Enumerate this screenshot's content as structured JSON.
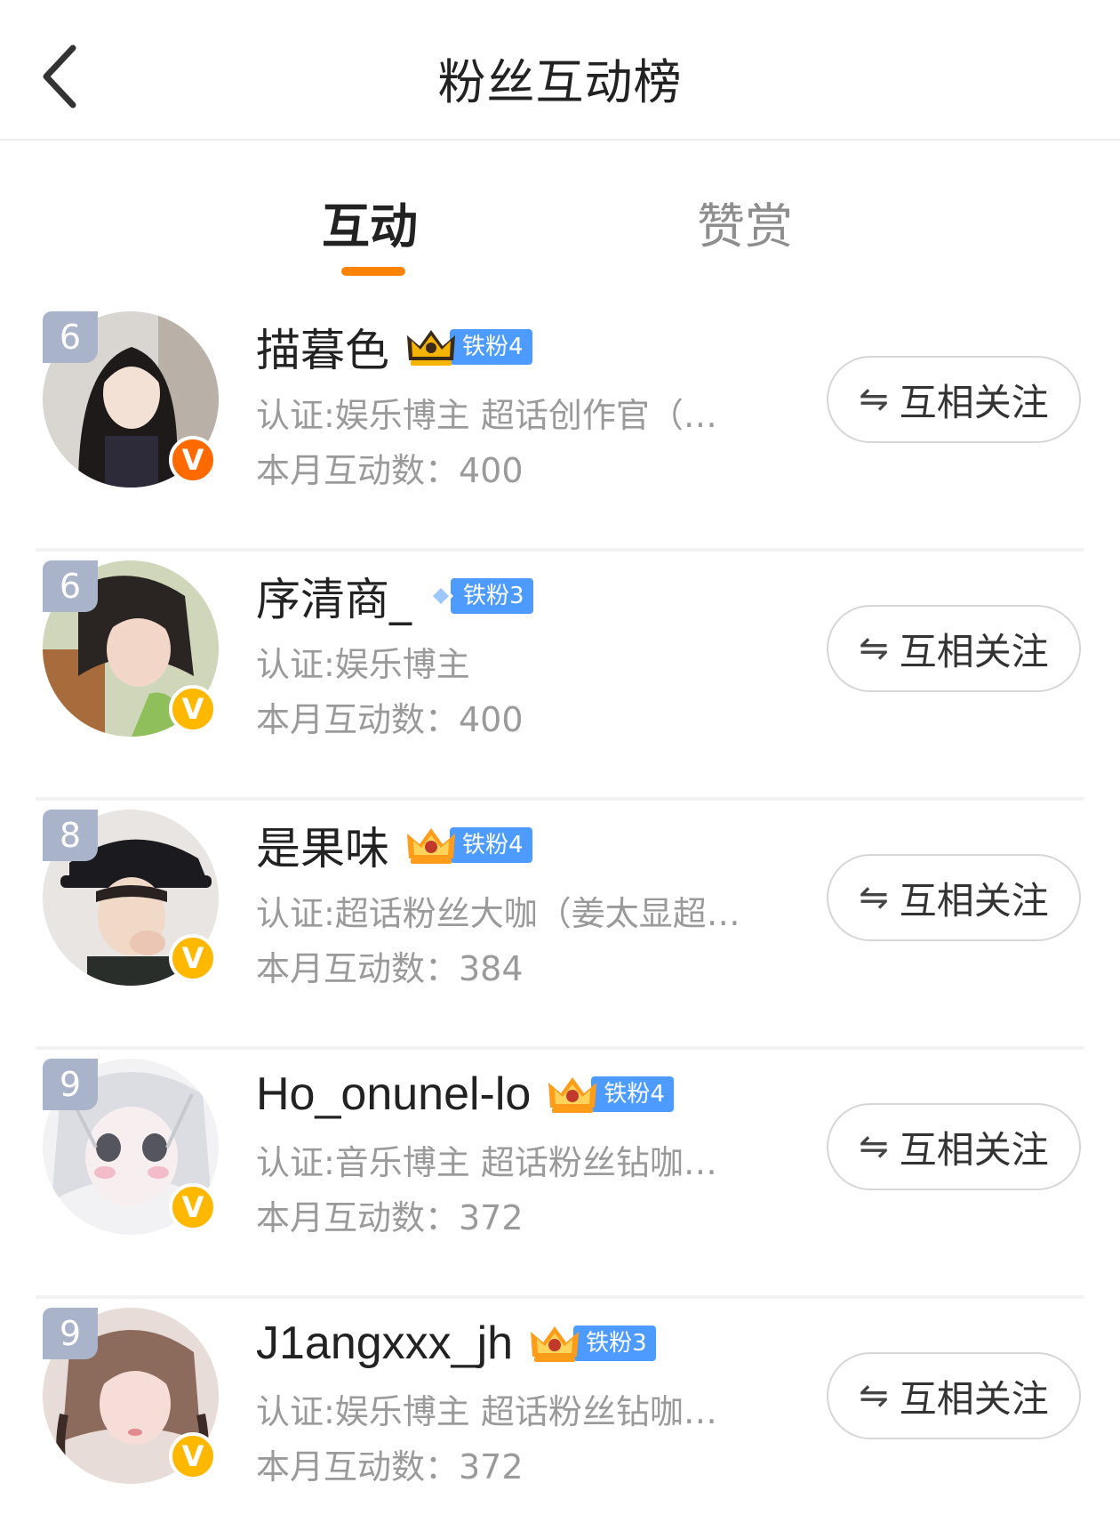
{
  "header": {
    "title": "粉丝互动榜"
  },
  "tabs": [
    {
      "label": "互动",
      "active": true
    },
    {
      "label": "赞赏",
      "active": false
    }
  ],
  "colors": {
    "accent": "#ff8200",
    "fan_badge": "#4d9bff",
    "rank_badge": "#a9b3c9",
    "verify_orange": "#ff6a00",
    "verify_yellow": "#ffb800"
  },
  "users": [
    {
      "rank": "6",
      "name": "描暮色",
      "fan_badge_icon": "crown-icon",
      "fan_badge_label": "铁粉4",
      "certification": "认证:娱乐博主 超话创作官（…",
      "count_text": "本月互动数：400",
      "verify": "V",
      "verify_color": "orange",
      "follow_icon": "⇋",
      "follow_label": "互相关注"
    },
    {
      "rank": "6",
      "name": "序清商_",
      "fan_badge_icon": "diamond-icon",
      "fan_badge_label": "铁粉3",
      "certification": "认证:娱乐博主",
      "count_text": "本月互动数：400",
      "verify": "V",
      "verify_color": "yellow",
      "follow_icon": "⇋",
      "follow_label": "互相关注"
    },
    {
      "rank": "8",
      "name": "是果味",
      "fan_badge_icon": "crown-icon",
      "fan_badge_label": "铁粉4",
      "certification": "认证:超话粉丝大咖（姜太显超…",
      "count_text": "本月互动数：384",
      "verify": "V",
      "verify_color": "yellow",
      "follow_icon": "⇋",
      "follow_label": "互相关注"
    },
    {
      "rank": "9",
      "name": "Ho_onunel-lo",
      "fan_badge_icon": "crown-icon",
      "fan_badge_label": "铁粉4",
      "certification": "认证:音乐博主 超话粉丝钻咖…",
      "count_text": "本月互动数：372",
      "verify": "V",
      "verify_color": "yellow",
      "follow_icon": "⇋",
      "follow_label": "互相关注"
    },
    {
      "rank": "9",
      "name": "J1angxxx_jh",
      "fan_badge_icon": "crown-icon",
      "fan_badge_label": "铁粉3",
      "certification": "认证:娱乐博主 超话粉丝钻咖…",
      "count_text": "本月互动数：372",
      "verify": "V",
      "verify_color": "yellow",
      "follow_icon": "⇋",
      "follow_label": "互相关注"
    }
  ]
}
